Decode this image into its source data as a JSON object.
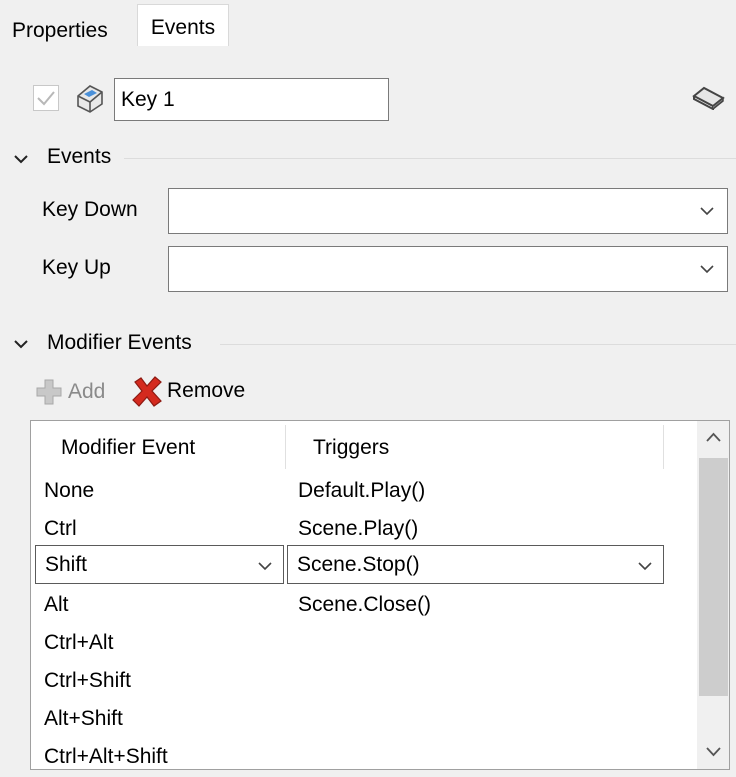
{
  "tabs": [
    {
      "label": "Properties",
      "active": false
    },
    {
      "label": "Events",
      "active": true
    }
  ],
  "object": {
    "enabled": true,
    "name": "Key 1"
  },
  "events_section": {
    "title": "Events",
    "fields": [
      {
        "label": "Key Down",
        "value": ""
      },
      {
        "label": "Key Up",
        "value": ""
      }
    ]
  },
  "modifier_section": {
    "title": "Modifier Events",
    "toolbar": {
      "add_label": "Add",
      "remove_label": "Remove"
    },
    "columns": [
      "Modifier Event",
      "Triggers"
    ],
    "rows": [
      {
        "modifier": "None",
        "trigger": "Default.Play()"
      },
      {
        "modifier": "Ctrl",
        "trigger": "Scene.Play()"
      },
      {
        "modifier": "Shift",
        "trigger": "Scene.Stop()"
      },
      {
        "modifier": "Alt",
        "trigger": "Scene.Close()"
      },
      {
        "modifier": "Ctrl+Alt",
        "trigger": ""
      },
      {
        "modifier": "Ctrl+Shift",
        "trigger": ""
      },
      {
        "modifier": "Alt+Shift",
        "trigger": ""
      },
      {
        "modifier": "Ctrl+Alt+Shift",
        "trigger": ""
      }
    ]
  },
  "colors": {
    "accent": "#1e73be",
    "remove_red": "#d42a1e",
    "panel_bg": "#f0f0f0"
  }
}
